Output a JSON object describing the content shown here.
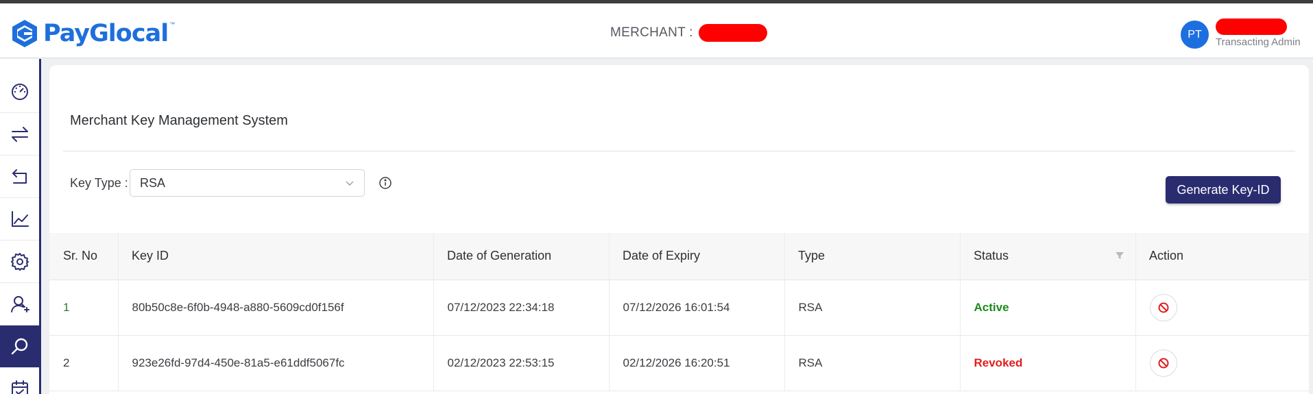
{
  "header": {
    "brand": "PayGlocal",
    "brand_tm": "™",
    "merchant_label": "MERCHANT :",
    "user": {
      "initials": "PT",
      "role": "Transacting Admin"
    }
  },
  "sidebar": {
    "items": [
      {
        "icon": "dashboard-gauge-icon",
        "active": false
      },
      {
        "icon": "transactions-arrows-icon",
        "active": false
      },
      {
        "icon": "refund-return-icon",
        "active": false
      },
      {
        "icon": "analytics-chart-icon",
        "active": false
      },
      {
        "icon": "settings-gear-icon",
        "active": false
      },
      {
        "icon": "user-management-icon",
        "active": false
      },
      {
        "icon": "search-icon",
        "active": true
      },
      {
        "icon": "calendar-check-icon",
        "active": false
      }
    ]
  },
  "main": {
    "title": "Merchant Key Management System",
    "key_type_label": "Key Type :",
    "key_type_value": "RSA",
    "generate_button": "Generate Key-ID",
    "table": {
      "headers": [
        "Sr. No",
        "Key ID",
        "Date of Generation",
        "Date of Expiry",
        "Type",
        "Status",
        "Action"
      ],
      "rows": [
        {
          "sr": "1",
          "key_id": "80b50c8e-6f0b-4948-a880-5609cd0f156f",
          "generated": "07/12/2023 22:34:18",
          "expiry": "07/12/2026 16:01:54",
          "type": "RSA",
          "status": "Active"
        },
        {
          "sr": "2",
          "key_id": "923e26fd-97d4-450e-81a5-e61ddf5067fc",
          "generated": "02/12/2023 22:53:15",
          "expiry": "02/12/2026 16:20:51",
          "type": "RSA",
          "status": "Revoked"
        }
      ]
    }
  },
  "colors": {
    "brand_blue": "#1e6fdc",
    "sidebar_navy": "#2a2c70",
    "status_active": "#1b8a1b",
    "status_revoked": "#e31b1b",
    "avatar_blue": "#1d6fe0"
  }
}
